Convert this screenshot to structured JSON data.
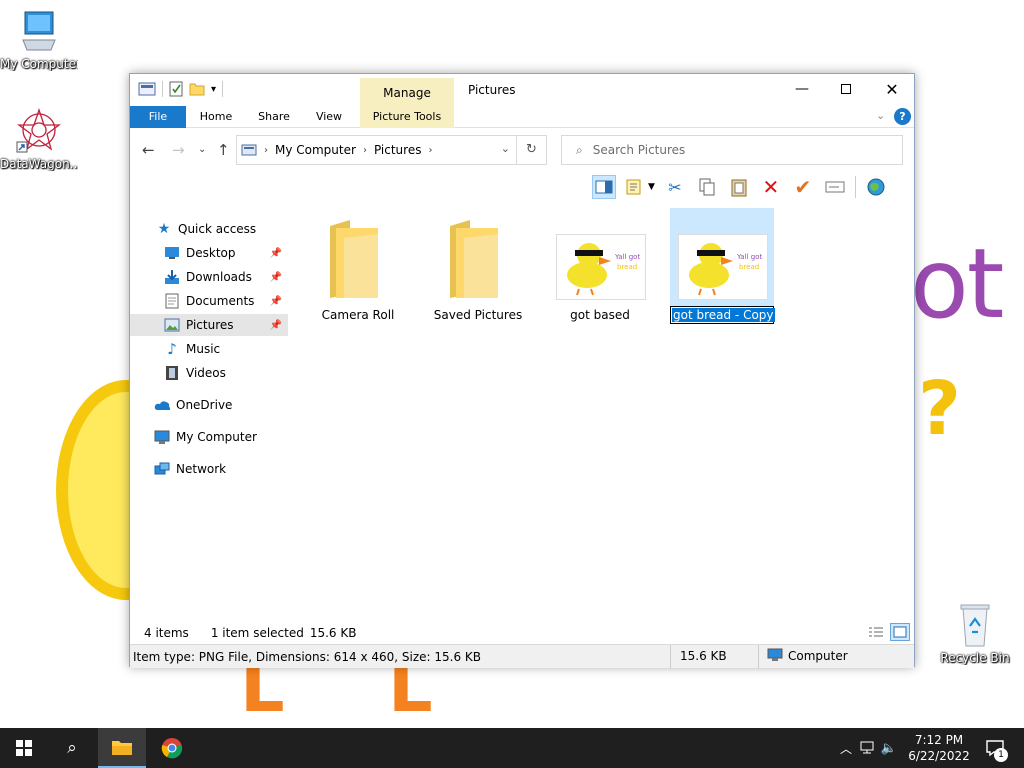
{
  "desktop": {
    "wallpaper_text_ot": "ot",
    "wallpaper_text_q": "?",
    "wallpaper_text_l1": "L",
    "wallpaper_text_l2": "L",
    "icons": [
      {
        "label": "My Computer",
        "icon": "computer-icon"
      },
      {
        "label": "DataWagon...",
        "icon": "datawagon-icon"
      },
      {
        "label": "Recycle Bin",
        "icon": "recycle-bin-icon"
      }
    ]
  },
  "window": {
    "title": "Pictures",
    "contextual_tab": "Manage",
    "ribbon_tabs": [
      "File",
      "Home",
      "Share",
      "View",
      "Picture Tools"
    ],
    "address": {
      "segments": [
        "My Computer",
        "Pictures"
      ]
    },
    "search": {
      "placeholder": "Search Pictures"
    },
    "nav": [
      {
        "label": "Quick access",
        "icon": "star-icon"
      },
      {
        "label": "Desktop",
        "icon": "desktop-icon",
        "pinned": true
      },
      {
        "label": "Downloads",
        "icon": "downloads-icon",
        "pinned": true
      },
      {
        "label": "Documents",
        "icon": "documents-icon",
        "pinned": true
      },
      {
        "label": "Pictures",
        "icon": "pictures-icon",
        "pinned": true,
        "selected": true
      },
      {
        "label": "Music",
        "icon": "music-icon"
      },
      {
        "label": "Videos",
        "icon": "videos-icon"
      },
      {
        "label": "OneDrive",
        "icon": "cloud-icon"
      },
      {
        "label": "My Computer",
        "icon": "computer-icon"
      },
      {
        "label": "Network",
        "icon": "network-icon"
      }
    ],
    "items": [
      {
        "name": "Camera Roll",
        "type": "folder"
      },
      {
        "name": "Saved Pictures",
        "type": "folder"
      },
      {
        "name": "got based",
        "type": "image",
        "thumb_text": "Yall got\nbread"
      },
      {
        "name": "got bread - Copy",
        "type": "image",
        "thumb_text": "Yall got\nbread",
        "selected": true,
        "renaming": true
      }
    ],
    "status": {
      "count": "4 items",
      "selection": "1 item selected",
      "size": "15.6 KB"
    },
    "details": {
      "info": "Item type: PNG File, Dimensions: 614 x 460, Size: 15.6 KB",
      "size": "15.6 KB",
      "location": "Computer"
    }
  },
  "taskbar": {
    "time": "7:12 PM",
    "date": "6/22/2022",
    "notification_count": "1"
  },
  "colors": {
    "accent": "#1979ca",
    "manage_tab": "#f8efc1",
    "selection": "#cce8ff",
    "taskbar": "#1f1f1f"
  }
}
